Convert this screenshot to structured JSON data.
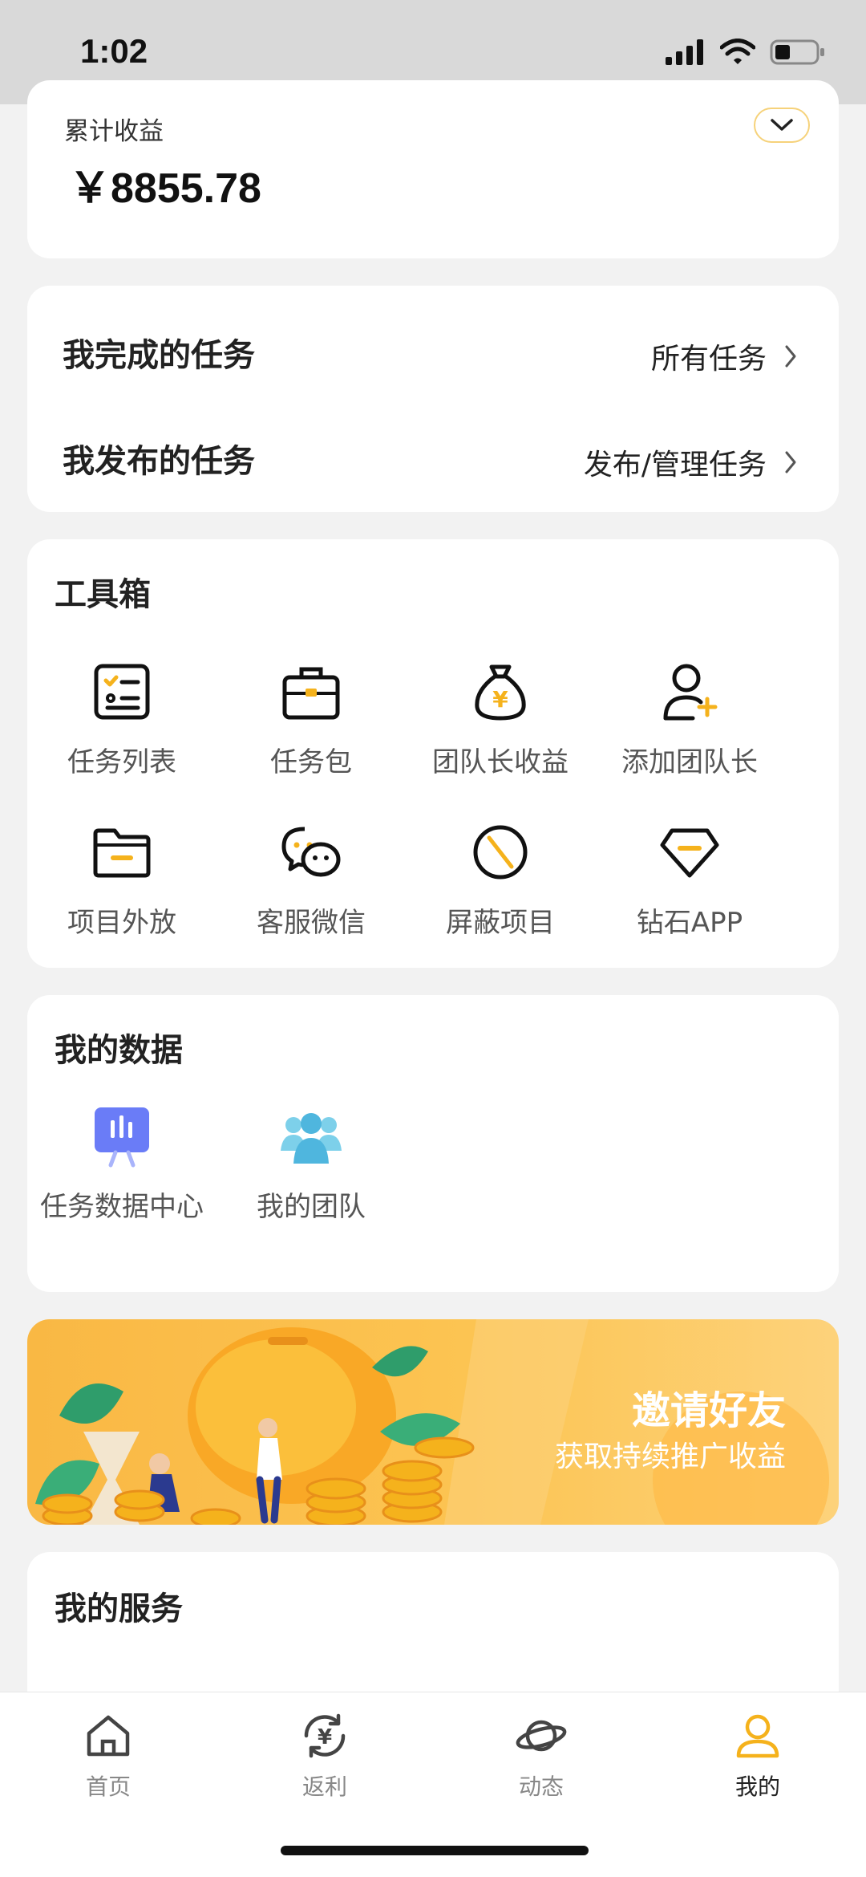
{
  "status_bar": {
    "time": "1:02"
  },
  "earnings": {
    "label": "累计收益",
    "value": "￥8855.78"
  },
  "tasks": [
    {
      "title": "我完成的任务",
      "link": "所有任务"
    },
    {
      "title": "我发布的任务",
      "link": "发布/管理任务"
    }
  ],
  "toolbox": {
    "title": "工具箱",
    "items": [
      {
        "label": "任务列表",
        "icon": "checklist-icon"
      },
      {
        "label": "任务包",
        "icon": "briefcase-icon"
      },
      {
        "label": "团队长收益",
        "icon": "money-bag-icon"
      },
      {
        "label": "添加团队长",
        "icon": "add-user-icon"
      },
      {
        "label": "项目外放",
        "icon": "folder-icon"
      },
      {
        "label": "客服微信",
        "icon": "wechat-icon"
      },
      {
        "label": "屏蔽项目",
        "icon": "block-icon"
      },
      {
        "label": "钻石APP",
        "icon": "diamond-icon"
      }
    ]
  },
  "my_data": {
    "title": "我的数据",
    "items": [
      {
        "label": "任务数据中心",
        "icon": "data-board-icon"
      },
      {
        "label": "我的团队",
        "icon": "team-icon"
      }
    ]
  },
  "banner": {
    "title": "邀请好友",
    "subtitle": "获取持续推广收益"
  },
  "my_services": {
    "title": "我的服务"
  },
  "tabbar": {
    "items": [
      {
        "label": "首页",
        "icon": "home-icon"
      },
      {
        "label": "返利",
        "icon": "rebate-icon"
      },
      {
        "label": "动态",
        "icon": "planet-icon"
      },
      {
        "label": "我的",
        "icon": "profile-icon",
        "active": true
      }
    ]
  },
  "colors": {
    "accent": "#f5b21c",
    "background": "#f2f2f2"
  }
}
